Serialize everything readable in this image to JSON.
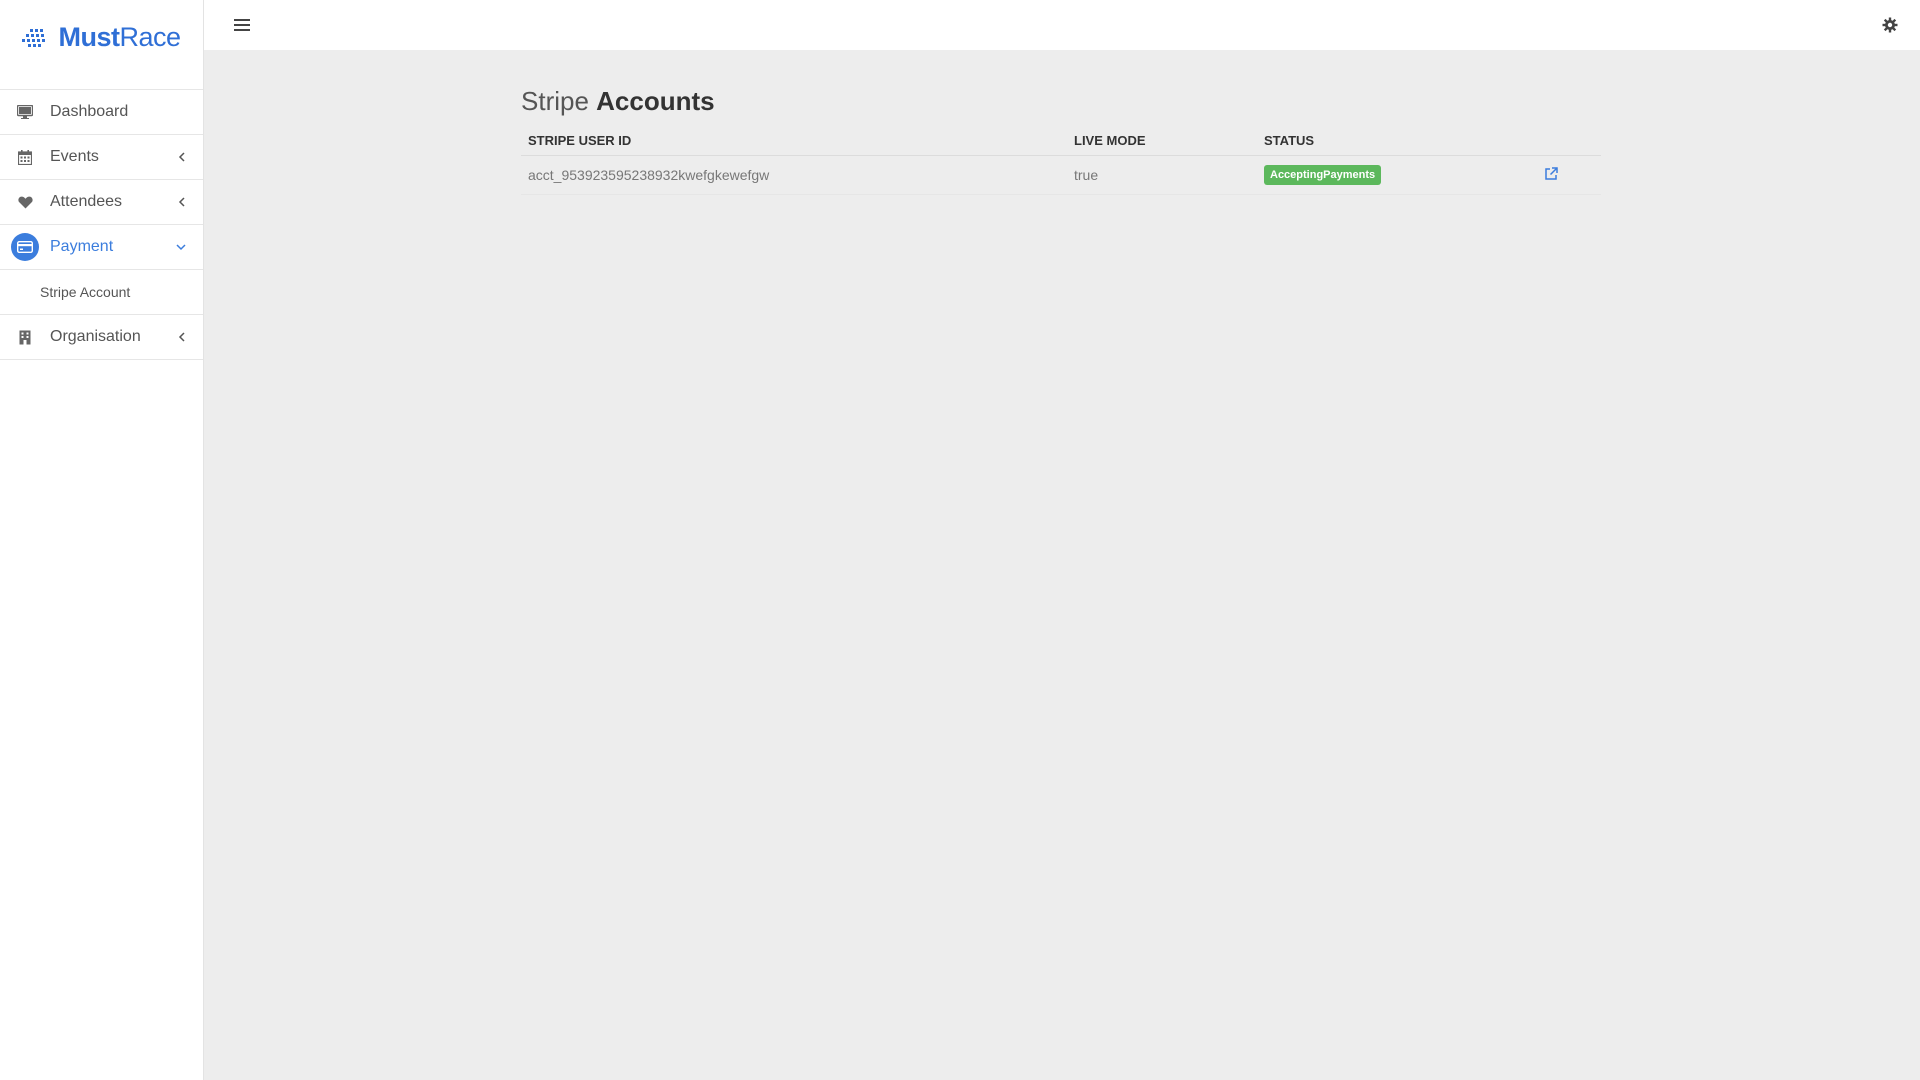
{
  "brand": {
    "name_bold": "Must",
    "name_light": "Race",
    "color": "#2f6fd6"
  },
  "sidebar": {
    "items": [
      {
        "label": "Dashboard",
        "icon": "monitor-icon",
        "caret": ""
      },
      {
        "label": "Events",
        "icon": "calendar-icon",
        "caret": "chevron-left-icon"
      },
      {
        "label": "Attendees",
        "icon": "heart-icon",
        "caret": "chevron-left-icon"
      },
      {
        "label": "Payment",
        "icon": "credit-card-icon",
        "caret": "chevron-down-icon",
        "active": true
      },
      {
        "label": "Organisation",
        "icon": "building-icon",
        "caret": "chevron-left-icon"
      }
    ],
    "payment_sub": {
      "label": "Stripe Account"
    }
  },
  "header": {
    "menu_icon": "hamburger-icon",
    "settings_icon": "gear-icon"
  },
  "page": {
    "title_light": "Stripe",
    "title_bold": "Accounts"
  },
  "table": {
    "headers": [
      "STRIPE USER ID",
      "LIVE MODE",
      "STATUS"
    ],
    "rows": [
      {
        "stripe_user_id": "acct_953923595238932kwefgkewefgw",
        "live_mode": "true",
        "status": "AcceptingPayments",
        "action_icon": "external-link-icon"
      }
    ]
  },
  "colors": {
    "accent": "#3b7ddd",
    "status_success": "#5cb85c",
    "background": "#ededed"
  }
}
